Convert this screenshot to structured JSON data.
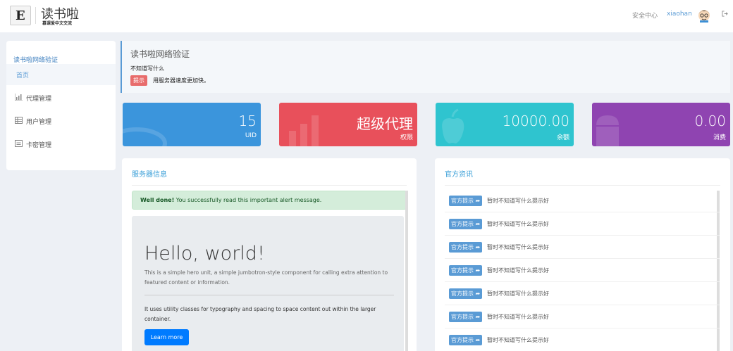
{
  "header": {
    "logo_letter": "E",
    "title": "读书啦",
    "subtitle": "慕课爱中文交流",
    "security_link": "安全中心",
    "username": "xiaohan"
  },
  "sidebar": {
    "title": "读书啦网络验证",
    "items": [
      {
        "label": "首页",
        "icon": "home"
      },
      {
        "label": "代理管理",
        "icon": "bar-chart-icon"
      },
      {
        "label": "用户管理",
        "icon": "table-icon"
      },
      {
        "label": "卡密管理",
        "icon": "card-icon"
      }
    ]
  },
  "notice": {
    "title": "读书啦网络验证",
    "line1": "不知道写什么",
    "tag": "提示",
    "text": "用服务器速度更加快。"
  },
  "cards": [
    {
      "value": "15",
      "label": "UID",
      "color": "#3b95dc"
    },
    {
      "value": "超级代理",
      "label": "权限",
      "color": "#e8505b"
    },
    {
      "value": "10000.00",
      "label": "余额",
      "color": "#2fc4cf"
    },
    {
      "value": "0.00",
      "label": "消费",
      "color": "#8f44b1"
    }
  ],
  "server_panel": {
    "title": "服务器信息",
    "alert_strong": "Well done!",
    "alert_text": " You successfully read this important alert message.",
    "jumbo_heading": "Hello, world!",
    "jumbo_lead": "This is a simple hero unit, a simple jumbotron-style component for calling extra attention to featured content or information.",
    "jumbo_body": "It uses utility classes for typography and spacing to space content out within the larger container.",
    "jumbo_button": "Learn more"
  },
  "news_panel": {
    "title": "官方资讯",
    "items": [
      {
        "tag": "官方提示",
        "text": "暂时不知道写什么提示好"
      },
      {
        "tag": "官方提示",
        "text": "暂时不知道写什么提示好"
      },
      {
        "tag": "官方提示",
        "text": "暂时不知道写什么提示好"
      },
      {
        "tag": "官方提示",
        "text": "暂时不知道写什么提示好"
      },
      {
        "tag": "官方提示",
        "text": "暂时不知道写什么提示好"
      },
      {
        "tag": "官方提示",
        "text": "暂时不知道写什么提示好"
      },
      {
        "tag": "官方提示",
        "text": "暂时不知道写什么提示好"
      }
    ]
  }
}
